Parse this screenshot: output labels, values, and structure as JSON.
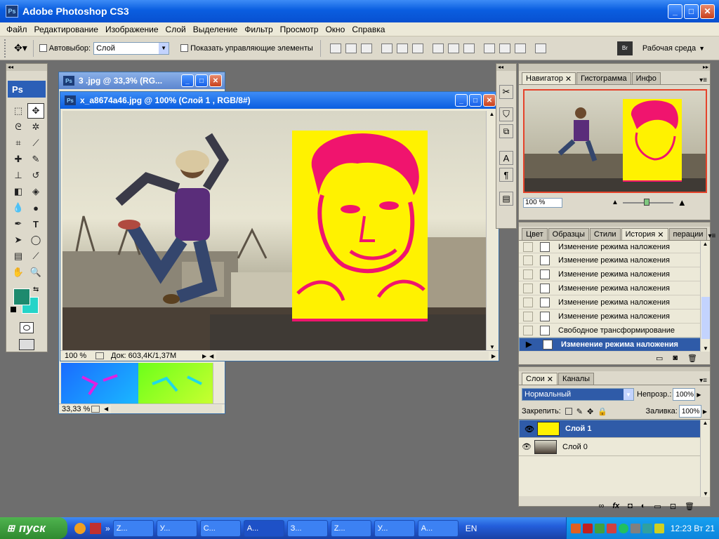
{
  "app": {
    "title": "Adobe Photoshop CS3",
    "icon": "Ps"
  },
  "menu": [
    "Файл",
    "Редактирование",
    "Изображение",
    "Слой",
    "Выделение",
    "Фильтр",
    "Просмотр",
    "Окно",
    "Справка"
  ],
  "options": {
    "autoselect_label": "Автовыбор:",
    "autoselect_value": "Слой",
    "show_controls_label": "Показать управляющие элементы",
    "workspace_label": "Рабочая среда"
  },
  "doc_back": {
    "title": "3 .jpg @ 33,3% (RG...",
    "zoom": "33,33 %"
  },
  "doc_front": {
    "title": "x_a8674a46.jpg @ 100% (Слой 1 , RGB/8#)",
    "zoom": "100 %",
    "doc_info": "Док: 603,4K/1,37M"
  },
  "colors": {
    "foreground": "#1e8a6e",
    "background": "#25d4c8",
    "overlay_yellow": "#fff200",
    "overlay_magenta": "#f0146e"
  },
  "navigator": {
    "tabs": [
      "Навигатор",
      "Гистограмма",
      "Инфо"
    ],
    "zoom": "100 %"
  },
  "history": {
    "tabs": [
      "Цвет",
      "Образцы",
      "Стили",
      "История",
      "перации"
    ],
    "items": [
      "Изменение режима наложения",
      "Изменение режима наложения",
      "Изменение режима наложения",
      "Изменение режима наложения",
      "Изменение режима наложения",
      "Изменение режима наложения",
      "Свободное трансформирование",
      "Изменение режима наложения"
    ]
  },
  "layers": {
    "tabs": [
      "Слои",
      "Каналы"
    ],
    "blend_mode": "Нормальный",
    "opacity_label": "Непрозр.:",
    "opacity": "100%",
    "lock_label": "Закрепить:",
    "fill_label": "Заливка:",
    "fill": "100%",
    "items": [
      "Слой 1",
      "Слой 0"
    ]
  },
  "taskbar": {
    "start": "пуск",
    "tasks": [
      "Z...",
      "У...",
      "С...",
      "А...",
      "З...",
      "Z...",
      "У...",
      "А..."
    ],
    "lang": "EN",
    "clock": "12:23 Вт 21"
  }
}
